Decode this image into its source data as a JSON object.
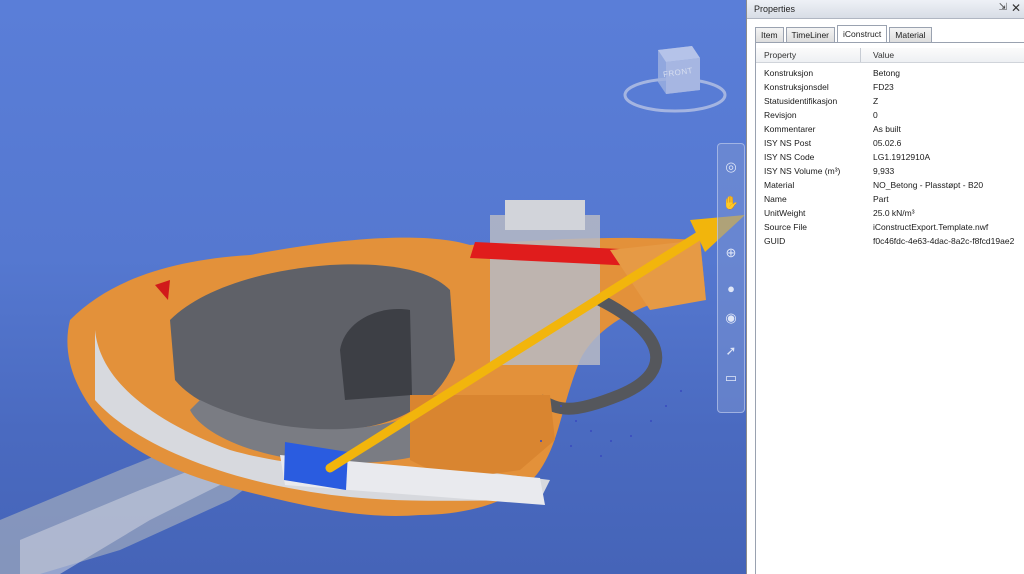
{
  "panel": {
    "title": "Properties",
    "tabs": [
      {
        "label": "Item",
        "active": false
      },
      {
        "label": "TimeLiner",
        "active": false
      },
      {
        "label": "iConstruct",
        "active": true
      },
      {
        "label": "Material",
        "active": false
      }
    ],
    "columns": {
      "property": "Property",
      "value": "Value"
    },
    "rows": [
      {
        "property": "Konstruksjon",
        "value": "Betong"
      },
      {
        "property": "Konstruksjonsdel",
        "value": "FD23"
      },
      {
        "property": "Statusidentifikasjon",
        "value": "Z"
      },
      {
        "property": "Revisjon",
        "value": "0"
      },
      {
        "property": "Kommentarer",
        "value": "As built"
      },
      {
        "property": "ISY NS Post",
        "value": "05.02.6"
      },
      {
        "property": "ISY NS Code",
        "value": "LG1.1912910A"
      },
      {
        "property": "ISY NS Volume (m³)",
        "value": "9,933"
      },
      {
        "property": "Material",
        "value": "NO_Betong - Plasstøpt - B20"
      },
      {
        "property": "Name",
        "value": "Part"
      },
      {
        "property": "UnitWeight",
        "value": "25.0 kN/m³"
      },
      {
        "property": "Source File",
        "value": "iConstructExport.Template.nwf"
      },
      {
        "property": "GUID",
        "value": "f0c46fdc-4e63-4dac-8a2c-f8fcd19ae2"
      }
    ]
  },
  "viewcube": {
    "face_label": "FRONT"
  },
  "colors": {
    "background_top": "#5a7ed8",
    "arrow": "#f2b50c",
    "selection": "#2a5ce0",
    "structure": "#e08b30",
    "highlight": "#e02020"
  },
  "icons": {
    "close": "close-icon",
    "pin": "pin-icon",
    "nav": [
      "steering-wheel-icon",
      "pan-icon",
      "zoom-icon",
      "orbit-icon",
      "look-icon",
      "select-icon",
      "walk-icon"
    ]
  }
}
